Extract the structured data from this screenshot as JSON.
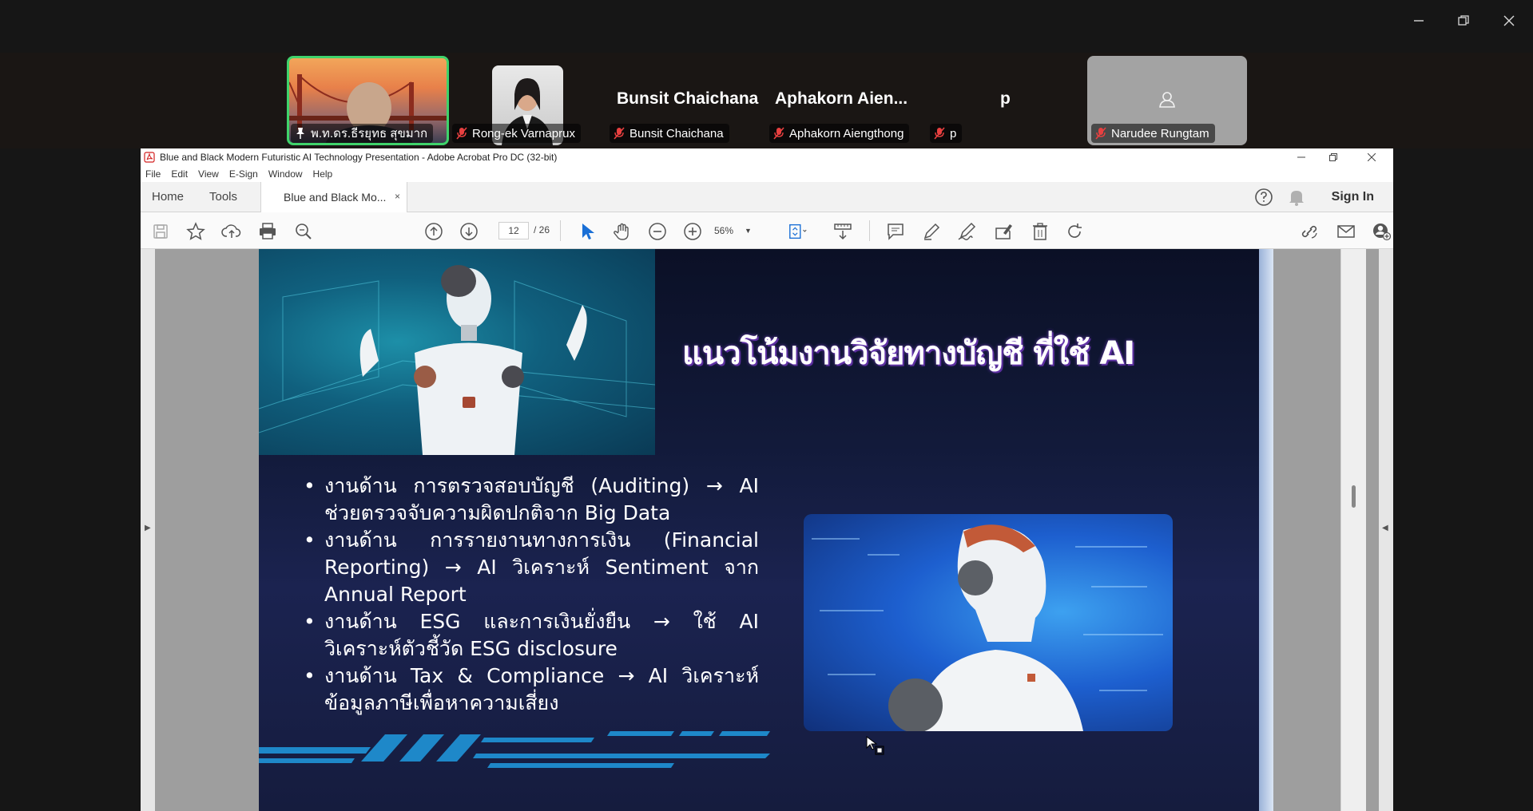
{
  "meeting": {
    "participants": [
      {
        "label": "พ.ท.ดร.ธีรยุทธ สุขมาก",
        "pinned": true
      },
      {
        "label": "Rong-ek Varnaprux",
        "muted": true
      },
      {
        "name_big": "Bunsit Chaichana",
        "label": "Bunsit Chaichana",
        "muted": true
      },
      {
        "name_big": "Aphakorn  Aien...",
        "label": "Aphakorn Aiengthong",
        "muted": true
      },
      {
        "name_big": "p",
        "label": "p",
        "muted": true
      },
      {
        "label": "Narudee Rungtam",
        "muted": true
      }
    ],
    "colors": {
      "active_border": "#3fd36b",
      "bg": "#161616"
    }
  },
  "acrobat": {
    "window_title": "Blue and Black Modern Futuristic AI Technology Presentation - Adobe Acrobat Pro DC (32-bit)",
    "menu": [
      "File",
      "Edit",
      "View",
      "E-Sign",
      "Window",
      "Help"
    ],
    "tabs": {
      "home": "Home",
      "tools": "Tools",
      "document": "Blue and Black Mo...",
      "close": "×"
    },
    "sign_in": "Sign In",
    "page_current": "12",
    "page_total": "/ 26",
    "zoom": "56%"
  },
  "slide": {
    "title": "แนวโน้มงานวิจัยทางบัญชี ที่ใช้ AI",
    "bullets": [
      "งานด้าน การตรวจสอบบัญชี (Auditing) → AI ช่วยตรวจจับความผิดปกติจาก Big Data",
      "งานด้าน การรายงานทางการเงิน (Financial Reporting) → AI วิเคราะห์ Sentiment จาก Annual Report",
      "งานด้าน ESG และการเงินยั่งยืน → ใช้ AI วิเคราะห์ตัวชี้วัด ESG disclosure",
      "งานด้าน Tax & Compliance → AI วิเคราะห์ข้อมูลภาษีเพื่อหาความเสี่ยง"
    ],
    "colors": {
      "bg_top": "#0b1026",
      "bg_mid": "#1b2350",
      "accent": "#1e88c9",
      "title_shadow": "#5a2d9c"
    }
  }
}
